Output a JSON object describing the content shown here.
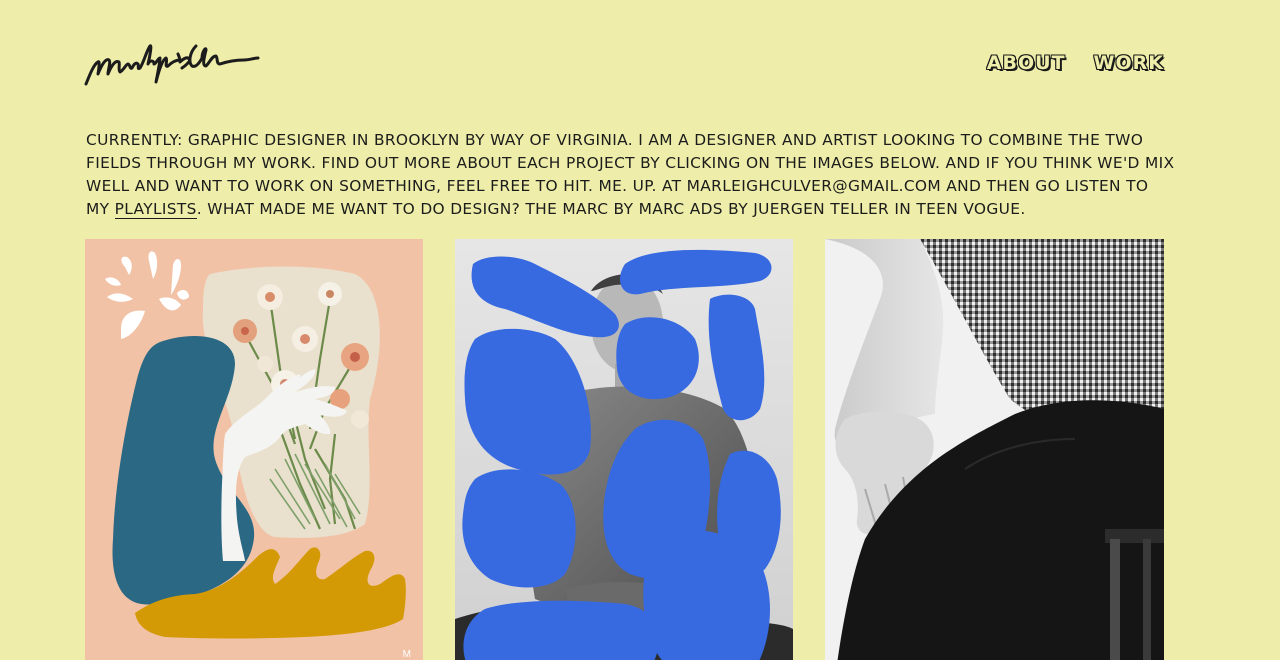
{
  "header": {
    "logo_text": "Marleigh Culver",
    "nav": [
      {
        "label": "ABOUT"
      },
      {
        "label": "WORK"
      }
    ]
  },
  "intro": {
    "text_before_link": "Currently: graphic designer in Brooklyn by way of Virginia. I am a designer and artist looking to combine the two fields through my work. Find out more about each project by clicking on the images below. And if you think we'd mix well and want to work on something, feel free to hit. me. up. at marleighculver@gmail.com and then go listen to my ",
    "link_text": "playlists",
    "text_after_link": ". What made me want to do design? The Marc by Marc ads by Juergen Teller in Teen Vogue."
  },
  "gallery": {
    "tiles": [
      {
        "name": "floral-collage-project"
      },
      {
        "name": "blue-blob-portrait-project"
      },
      {
        "name": "gingham-shirt-photo-project"
      }
    ]
  },
  "colors": {
    "background": "#eeeeaa",
    "text": "#1c1c1c",
    "peach": "#f2c2a6",
    "teal": "#2a6883",
    "mustard": "#d39a06",
    "blue": "#3769e0"
  }
}
